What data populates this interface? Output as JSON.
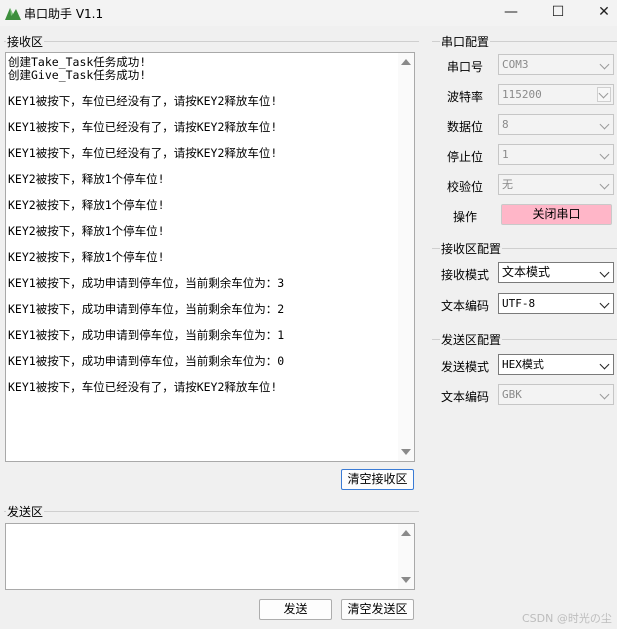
{
  "window": {
    "title": "串口助手 V1.1",
    "minimize": "—",
    "maximize": "☐",
    "close": "✕"
  },
  "receive": {
    "group_title": "接收区",
    "lines": [
      "创建Take_Task任务成功!",
      "创建Give_Task任务成功!",
      "",
      "KEY1被按下，车位已经没有了，请按KEY2释放车位!",
      "",
      "KEY1被按下，车位已经没有了，请按KEY2释放车位!",
      "",
      "KEY1被按下，车位已经没有了，请按KEY2释放车位!",
      "",
      "KEY2被按下，释放1个停车位!",
      "",
      "KEY2被按下，释放1个停车位!",
      "",
      "KEY2被按下，释放1个停车位!",
      "",
      "KEY2被按下，释放1个停车位!",
      "",
      "KEY1被按下，成功申请到停车位，当前剩余车位为：3",
      "",
      "KEY1被按下，成功申请到停车位，当前剩余车位为：2",
      "",
      "KEY1被按下，成功申请到停车位，当前剩余车位为：1",
      "",
      "KEY1被按下，成功申请到停车位，当前剩余车位为：0",
      "",
      "KEY1被按下，车位已经没有了，请按KEY2释放车位!"
    ],
    "clear_button": "清空接收区"
  },
  "send": {
    "group_title": "发送区",
    "text": "",
    "send_button": "发送",
    "clear_button": "清空发送区"
  },
  "serial_config": {
    "group_title": "串口配置",
    "port_label": "串口号",
    "port_value": "COM3",
    "baud_label": "波特率",
    "baud_value": "115200",
    "databits_label": "数据位",
    "databits_value": "8",
    "stopbits_label": "停止位",
    "stopbits_value": "1",
    "parity_label": "校验位",
    "parity_value": "无",
    "operation_label": "操作",
    "operation_button": "关闭串口",
    "operation_button_color": "#ffb6c8"
  },
  "receive_config": {
    "group_title": "接收区配置",
    "mode_label": "接收模式",
    "mode_value": "文本模式",
    "encoding_label": "文本编码",
    "encoding_value": "UTF-8"
  },
  "send_config": {
    "group_title": "发送区配置",
    "mode_label": "发送模式",
    "mode_value": "HEX模式",
    "encoding_label": "文本编码",
    "encoding_value": "GBK"
  },
  "watermark": "CSDN @时光の尘"
}
